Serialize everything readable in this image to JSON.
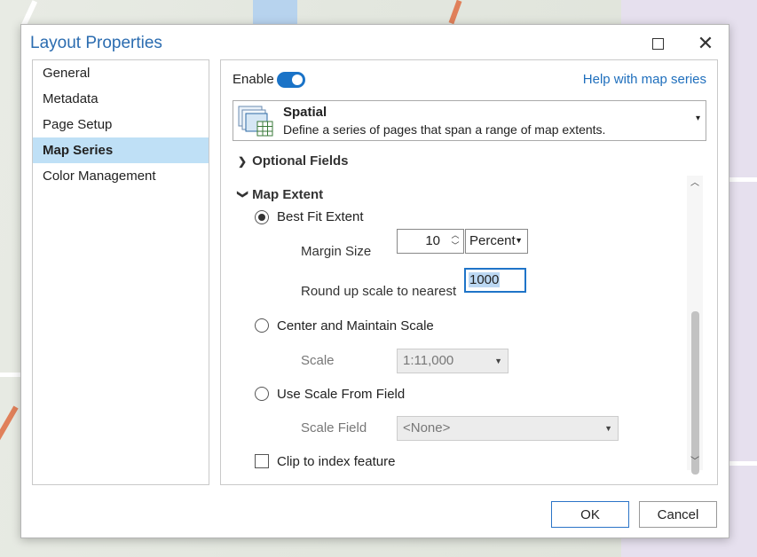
{
  "dialog": {
    "title": "Layout Properties"
  },
  "sidebar": {
    "items": [
      {
        "label": "General"
      },
      {
        "label": "Metadata"
      },
      {
        "label": "Page Setup"
      },
      {
        "label": "Map Series",
        "selected": true
      },
      {
        "label": "Color Management"
      }
    ]
  },
  "panel": {
    "enable_label": "Enable",
    "enable_on": true,
    "help_link": "Help with map series",
    "series_type": {
      "title": "Spatial",
      "description": "Define a series of pages that span a range of map extents.",
      "icon": "spatial-series-icon"
    },
    "optional_fields": "Optional Fields",
    "map_extent": "Map Extent",
    "best_fit": {
      "label": "Best Fit Extent",
      "selected": true,
      "margin_label": "Margin Size",
      "margin_value": "10",
      "margin_unit": "Percent",
      "round_label": "Round up scale to nearest",
      "round_value": "1000"
    },
    "center_scale": {
      "label": "Center and Maintain Scale",
      "scale_label": "Scale",
      "scale_value": "1:11,000"
    },
    "scale_field": {
      "label": "Use Scale From Field",
      "field_label": "Scale Field",
      "field_value": "<None>"
    },
    "clip": {
      "label": "Clip to index feature",
      "checked": false
    }
  },
  "buttons": {
    "ok": "OK",
    "cancel": "Cancel"
  },
  "colors": {
    "accent": "#1f6fbd",
    "selection": "#bfe0f6",
    "toggle": "#1a73c7"
  }
}
